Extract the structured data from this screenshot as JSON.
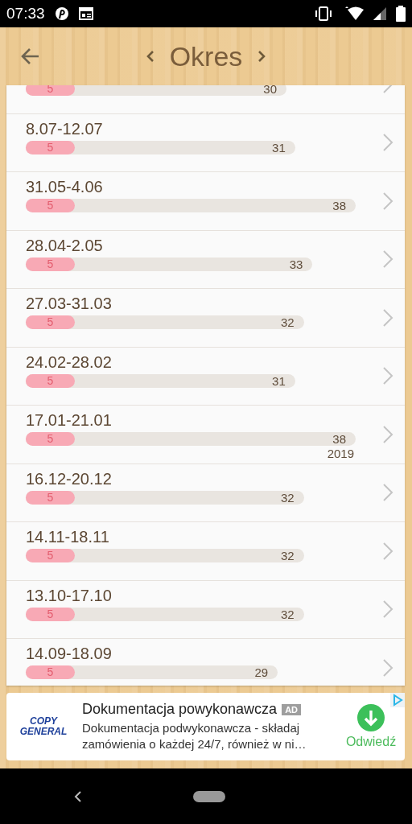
{
  "status_bar": {
    "time": "07:33"
  },
  "header": {
    "title": "Okres"
  },
  "periods": [
    {
      "count": "5",
      "total": "30"
    },
    {
      "date": "8.07-12.07",
      "count": "5",
      "total": "31"
    },
    {
      "date": "31.05-4.06",
      "count": "5",
      "total": "38"
    },
    {
      "date": "28.04-2.05",
      "count": "5",
      "total": "33"
    },
    {
      "date": "27.03-31.03",
      "count": "5",
      "total": "32"
    },
    {
      "date": "24.02-28.02",
      "count": "5",
      "total": "31"
    },
    {
      "date": "17.01-21.01",
      "count": "5",
      "total": "38",
      "year": "2019"
    },
    {
      "date": "16.12-20.12",
      "count": "5",
      "total": "32"
    },
    {
      "date": "14.11-18.11",
      "count": "5",
      "total": "32"
    },
    {
      "date": "13.10-17.10",
      "count": "5",
      "total": "32"
    },
    {
      "date": "14.09-18.09",
      "count": "5",
      "total": "29"
    }
  ],
  "ad": {
    "logo_top": "COPY",
    "logo_bottom": "GENERAL",
    "title": "Dokumentacja powykonawcza",
    "badge": "AD",
    "description": "Dokumentacja podwykonawcza - składaj zamówienia o każdej 24/7, również w ni…",
    "action": "Odwiedź"
  }
}
